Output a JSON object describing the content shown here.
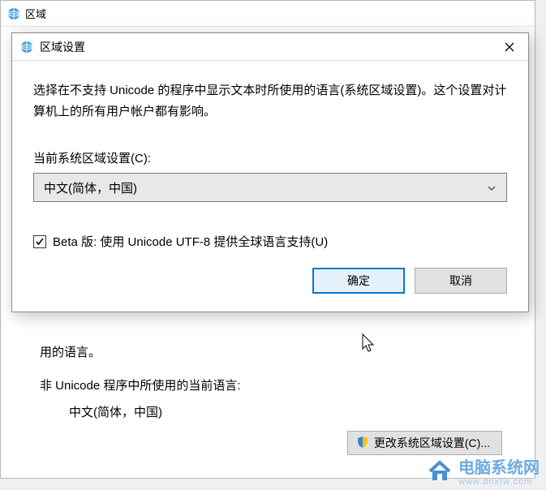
{
  "parent": {
    "title": "区域",
    "partial_line": "用的语言。",
    "non_unicode_label": "非 Unicode 程序中所使用的当前语言:",
    "non_unicode_value": "中文(简体，中国)",
    "change_button": "更改系统区域设置(C)..."
  },
  "dialog": {
    "title": "区域设置",
    "description": "选择在不支持 Unicode 的程序中显示文本时所使用的语言(系统区域设置)。这个设置对计算机上的所有用户帐户都有影响。",
    "combo_label": "当前系统区域设置(C):",
    "combo_value": "中文(简体，中国)",
    "checkbox_label": "Beta 版: 使用 Unicode UTF-8 提供全球语言支持(U)",
    "checkbox_checked": true,
    "ok": "确定",
    "cancel": "取消"
  },
  "watermark": {
    "main": "电脑系统网",
    "sub": "www.dnxtw.com"
  }
}
